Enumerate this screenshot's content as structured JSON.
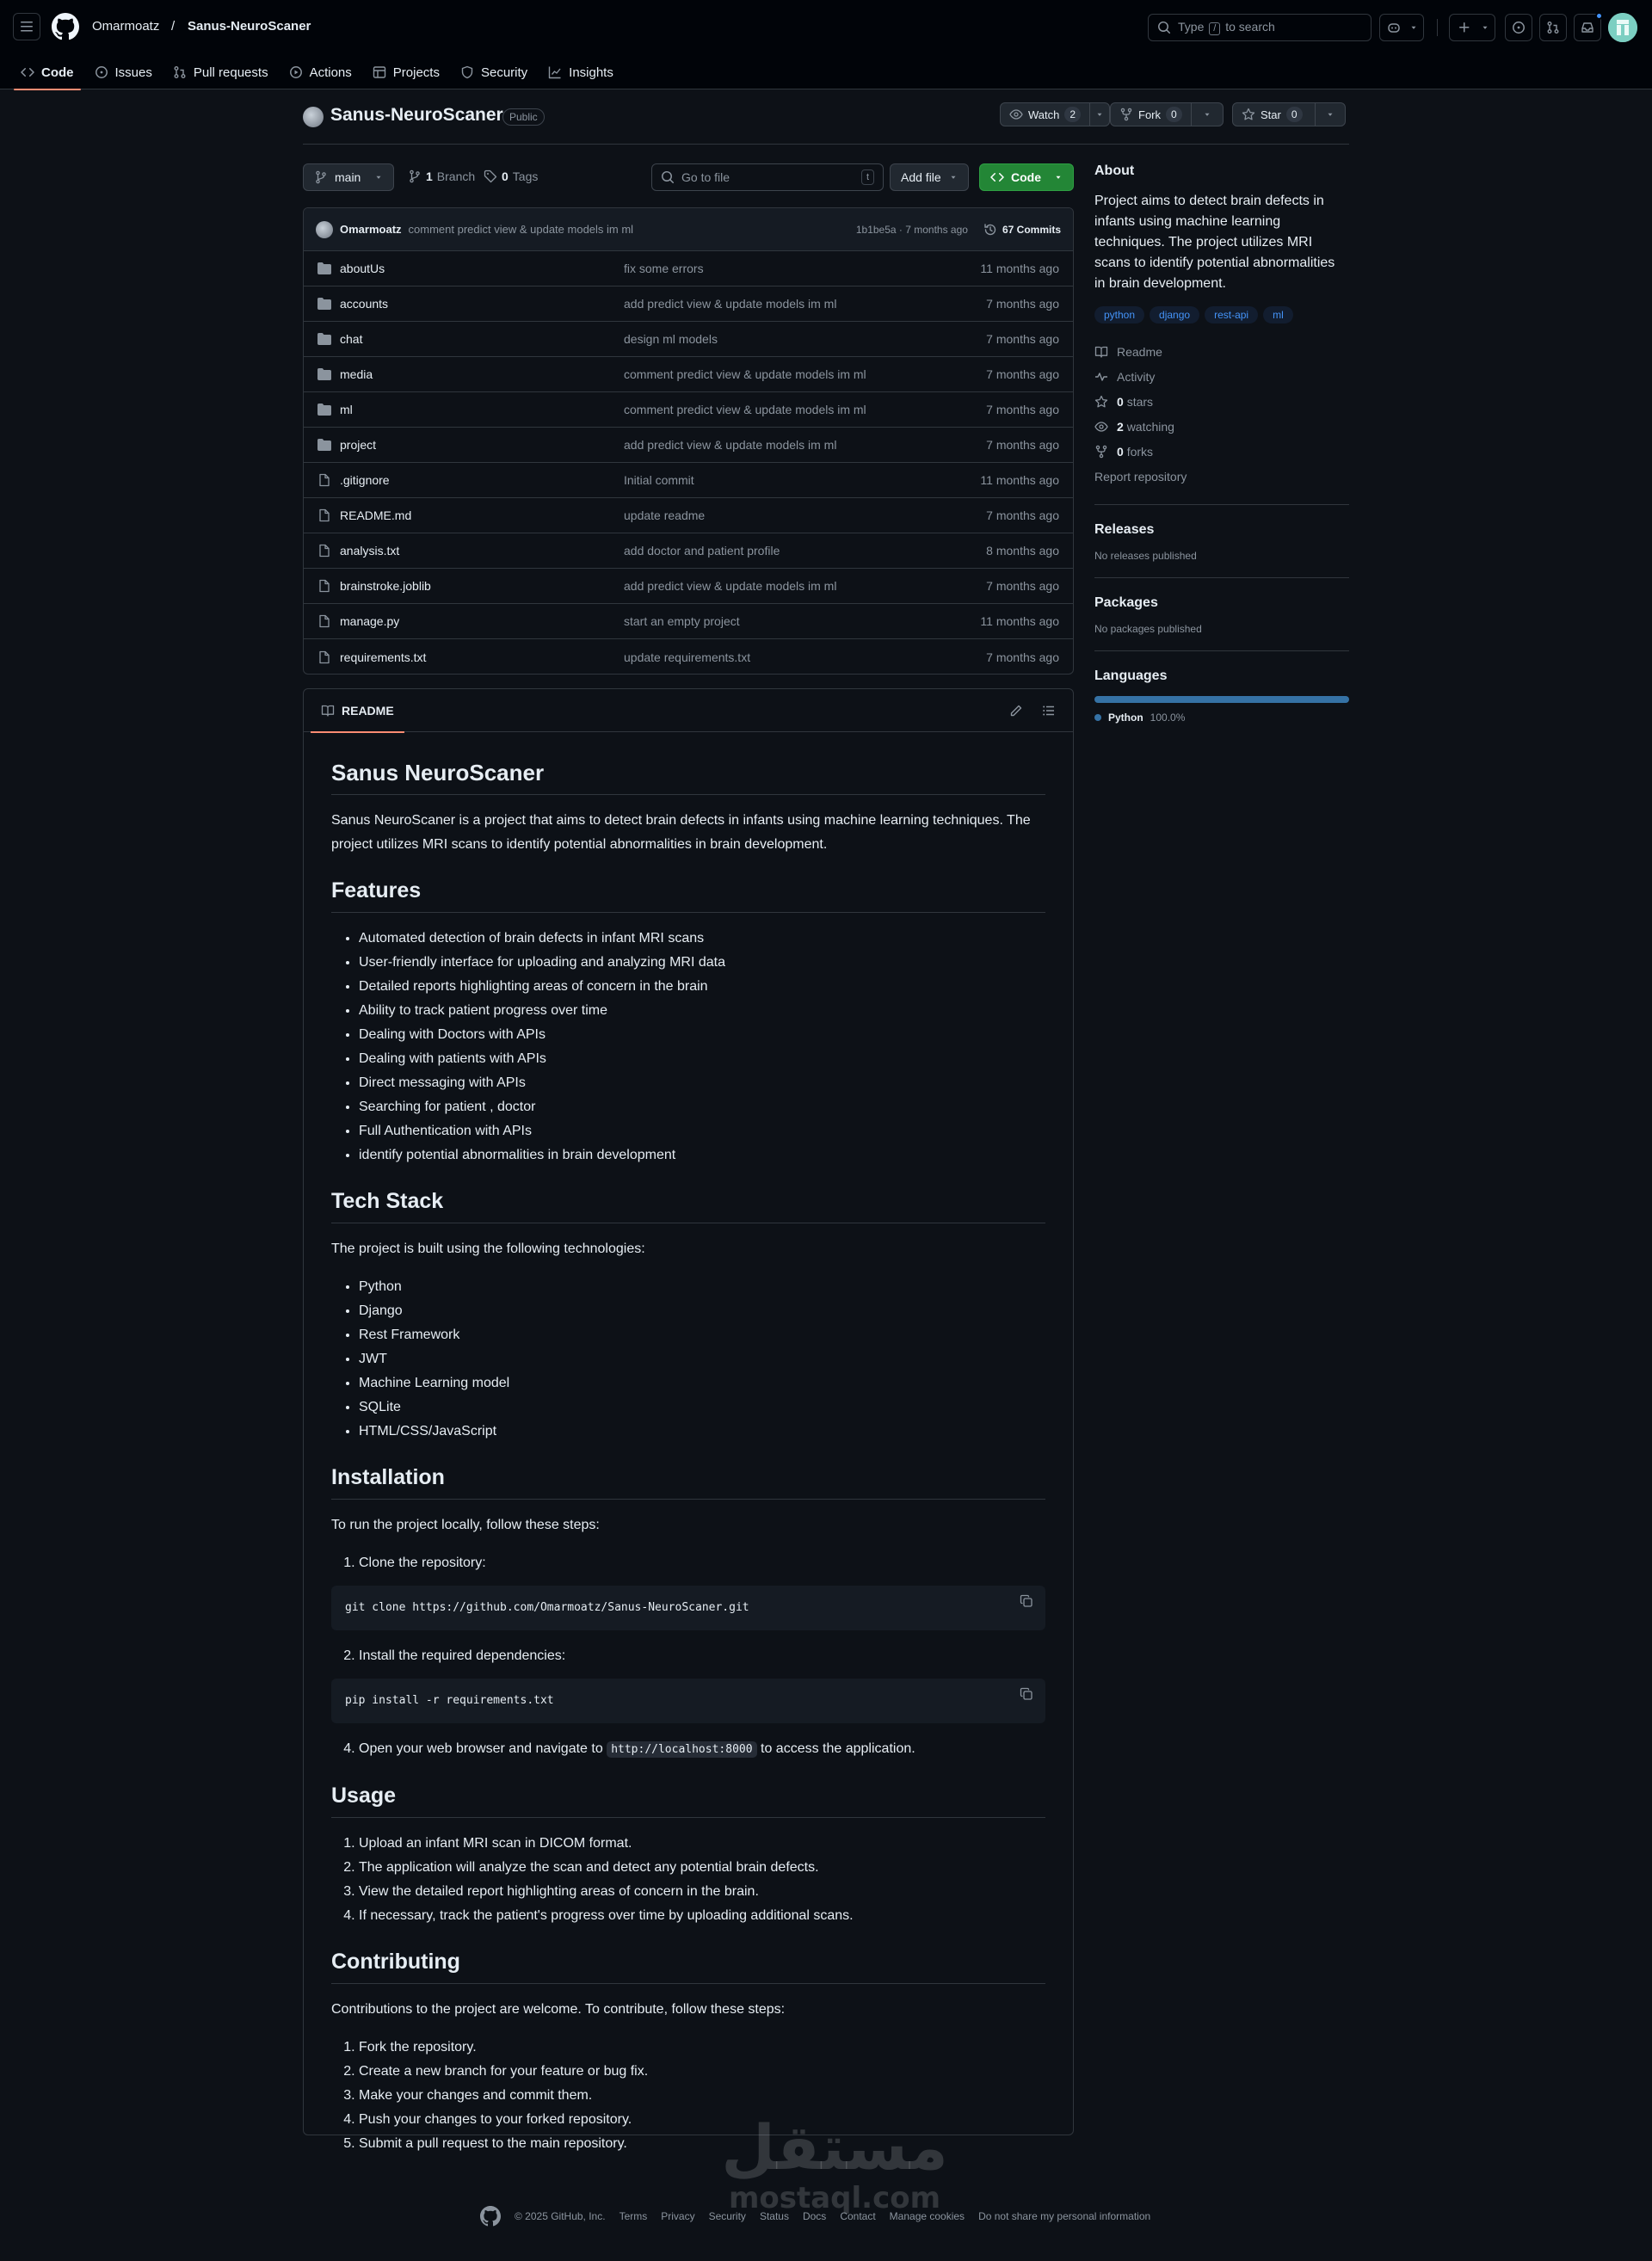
{
  "header": {
    "owner": "Omarmoatz",
    "separator": "/",
    "repo": "Sanus-NeuroScaner",
    "search_prefix": "Type",
    "search_key": "/",
    "search_suffix": "to search"
  },
  "tabs": [
    {
      "label": "Code",
      "icon": "code-icon"
    },
    {
      "label": "Issues",
      "icon": "issue-icon"
    },
    {
      "label": "Pull requests",
      "icon": "pull-request-icon"
    },
    {
      "label": "Actions",
      "icon": "play-icon"
    },
    {
      "label": "Projects",
      "icon": "table-icon"
    },
    {
      "label": "Security",
      "icon": "shield-icon"
    },
    {
      "label": "Insights",
      "icon": "graph-icon"
    }
  ],
  "repo_head": {
    "name": "Sanus-NeuroScaner",
    "visibility": "Public",
    "watch_label": "Watch",
    "watch_count": "2",
    "fork_label": "Fork",
    "fork_count": "0",
    "star_label": "Star",
    "star_count": "0"
  },
  "controls": {
    "branch": "main",
    "branches_count": "1",
    "branches_label": "Branch",
    "tags_count": "0",
    "tags_label": "Tags",
    "goto_placeholder": "Go to file",
    "goto_key": "t",
    "add_file": "Add file",
    "code": "Code"
  },
  "latest_commit": {
    "author": "Omarmoatz",
    "message": "comment predict view & update models im ml",
    "meta": "1b1be5a · 7 months ago",
    "commits": "67 Commits"
  },
  "files": [
    {
      "type": "dir",
      "name": "aboutUs",
      "message": "fix some errors",
      "date": "11 months ago"
    },
    {
      "type": "dir",
      "name": "accounts",
      "message": "add predict view & update models im ml",
      "date": "7 months ago"
    },
    {
      "type": "dir",
      "name": "chat",
      "message": "design ml models",
      "date": "7 months ago"
    },
    {
      "type": "dir",
      "name": "media",
      "message": "comment predict view & update models im ml",
      "date": "7 months ago"
    },
    {
      "type": "dir",
      "name": "ml",
      "message": "comment predict view & update models im ml",
      "date": "7 months ago"
    },
    {
      "type": "dir",
      "name": "project",
      "message": "add predict view & update models im ml",
      "date": "7 months ago"
    },
    {
      "type": "file",
      "name": ".gitignore",
      "message": "Initial commit",
      "date": "11 months ago"
    },
    {
      "type": "file",
      "name": "README.md",
      "message": "update readme",
      "date": "7 months ago"
    },
    {
      "type": "file",
      "name": "analysis.txt",
      "message": "add doctor and patient profile",
      "date": "8 months ago"
    },
    {
      "type": "file",
      "name": "brainstroke.joblib",
      "message": "add predict view & update models im ml",
      "date": "7 months ago"
    },
    {
      "type": "file",
      "name": "manage.py",
      "message": "start an empty project",
      "date": "11 months ago"
    },
    {
      "type": "file",
      "name": "requirements.txt",
      "message": "update requirements.txt",
      "date": "7 months ago"
    }
  ],
  "readme": {
    "tab": "README",
    "title": "Sanus NeuroScaner",
    "intro": "Sanus NeuroScaner is a project that aims to detect brain defects in infants using machine learning techniques. The project utilizes MRI scans to identify potential abnormalities in brain development.",
    "features_h": "Features",
    "features": [
      "Automated detection of brain defects in infant MRI scans",
      "User-friendly interface for uploading and analyzing MRI data",
      "Detailed reports highlighting areas of concern in the brain",
      "Ability to track patient progress over time",
      "Dealing with Doctors with APIs",
      "Dealing with patients with APIs",
      "Direct messaging with APIs",
      "Searching for patient , doctor",
      "Full Authentication with APIs",
      "identify potential abnormalities in brain development"
    ],
    "tech_h": "Tech Stack",
    "tech_intro": "The project is built using the following technologies:",
    "tech": [
      "Python",
      "Django",
      "Rest Framework",
      "JWT",
      "Machine Learning model",
      "SQLite",
      "HTML/CSS/JavaScript"
    ],
    "install_h": "Installation",
    "install_intro": "To run the project locally, follow these steps:",
    "step1": "Clone the repository:",
    "code1": "git clone https://github.com/Omarmoatz/Sanus-NeuroScaner.git",
    "step2": "Install the required dependencies:",
    "code2": "pip install -r requirements.txt",
    "step4_pre": "Open your web browser and navigate to",
    "step4_code": "http://localhost:8000",
    "step4_post": "to access the application.",
    "usage_h": "Usage",
    "usage": [
      "Upload an infant MRI scan in DICOM format.",
      "The application will analyze the scan and detect any potential brain defects.",
      "View the detailed report highlighting areas of concern in the brain.",
      "If necessary, track the patient's progress over time by uploading additional scans."
    ],
    "contrib_h": "Contributing",
    "contrib_intro": "Contributions to the project are welcome. To contribute, follow these steps:",
    "contrib": [
      "Fork the repository.",
      "Create a new branch for your feature or bug fix.",
      "Make your changes and commit them.",
      "Push your changes to your forked repository.",
      "Submit a pull request to the main repository."
    ]
  },
  "sidebar": {
    "about_h": "About",
    "about": "Project aims to detect brain defects in infants using machine learning techniques. The project utilizes MRI scans to identify potential abnormalities in brain development.",
    "topics": [
      "python",
      "django",
      "rest-api",
      "ml"
    ],
    "readme": "Readme",
    "activity": "Activity",
    "stars_count": "0",
    "stars_label": "stars",
    "watching_count": "2",
    "watching_label": "watching",
    "forks_count": "0",
    "forks_label": "forks",
    "report": "Report repository",
    "releases_h": "Releases",
    "releases": "No releases published",
    "packages_h": "Packages",
    "packages": "No packages published",
    "languages_h": "Languages",
    "lang_name": "Python",
    "lang_pct": "100.0%",
    "lang_fraction": 1.0,
    "lang_color": "#3572a5"
  },
  "watermark": {
    "arabic": "مستقل",
    "latin": "mostaql.com"
  },
  "footer": {
    "copyright": "© 2025 GitHub, Inc.",
    "links": [
      "Terms",
      "Privacy",
      "Security",
      "Status",
      "Docs",
      "Contact",
      "Manage cookies",
      "Do not share my personal information"
    ]
  },
  "colors": {
    "accent": "#fd8c73",
    "green": "#238636",
    "link": "#4493f8",
    "bg": "#0d1117"
  }
}
